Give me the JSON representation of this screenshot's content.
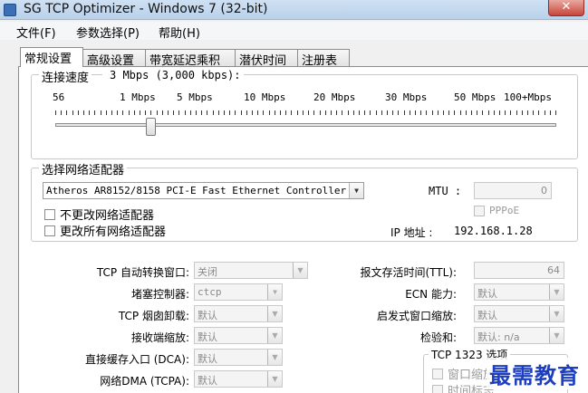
{
  "window": {
    "title": "SG TCP Optimizer - Windows 7 (32-bit)",
    "close_glyph": "✕"
  },
  "menu": [
    "文件(F)",
    "参数选择(P)",
    "帮助(H)"
  ],
  "tabs": [
    "常规设置",
    "高级设置",
    "带宽延迟乘积",
    "潜伏时间",
    "注册表"
  ],
  "speed": {
    "legend_label": "连接速度",
    "current": "3 Mbps (3,000 kbps):",
    "scale_labels": [
      "56",
      "1 Mbps",
      "5 Mbps",
      "10 Mbps",
      "20 Mbps",
      "30 Mbps",
      "50 Mbps",
      "100+Mbps"
    ],
    "slider_fraction": 0.19
  },
  "adapter": {
    "legend_label": "选择网络适配器",
    "selected": "Atheros AR8152/8158 PCI-E Fast Ethernet Controller",
    "mtu_label": "MTU :",
    "mtu_value": "0",
    "pppoe_label": "PPPoE",
    "no_change_label": "不更改网络适配器",
    "change_all_label": "更改所有网络适配器",
    "ip_label": "IP 地址 :",
    "ip_value": "192.168.1.28"
  },
  "left_settings": [
    {
      "label": "TCP 自动转换窗口:",
      "value": "关闭"
    },
    {
      "label": "堵塞控制器:",
      "value": "ctcp"
    },
    {
      "label": "TCP 烟囱卸载:",
      "value": "默认"
    },
    {
      "label": "接收端缩放:",
      "value": "默认"
    },
    {
      "label": "直接缓存入口 (DCA):",
      "value": "默认"
    },
    {
      "label": "网络DMA (TCPA):",
      "value": "默认"
    }
  ],
  "right_settings": {
    "ttl_label": "报文存活时间(TTL):",
    "ttl_value": "64",
    "ecn_label": "ECN 能力:",
    "ecn_value": "默认",
    "heuristic_label": "启发式窗口缩放:",
    "heuristic_value": "默认",
    "checksum_label": "检验和:",
    "checksum_value": "默认: n/a"
  },
  "rfc1323": {
    "legend_label": "TCP 1323 选项",
    "window_scale_label": "窗口缩放",
    "timestamps_label": "时间标志"
  },
  "watermark_text": "最需教育",
  "colors": {
    "watermark": "#1d3fbf",
    "close_button": "#c8453a"
  }
}
